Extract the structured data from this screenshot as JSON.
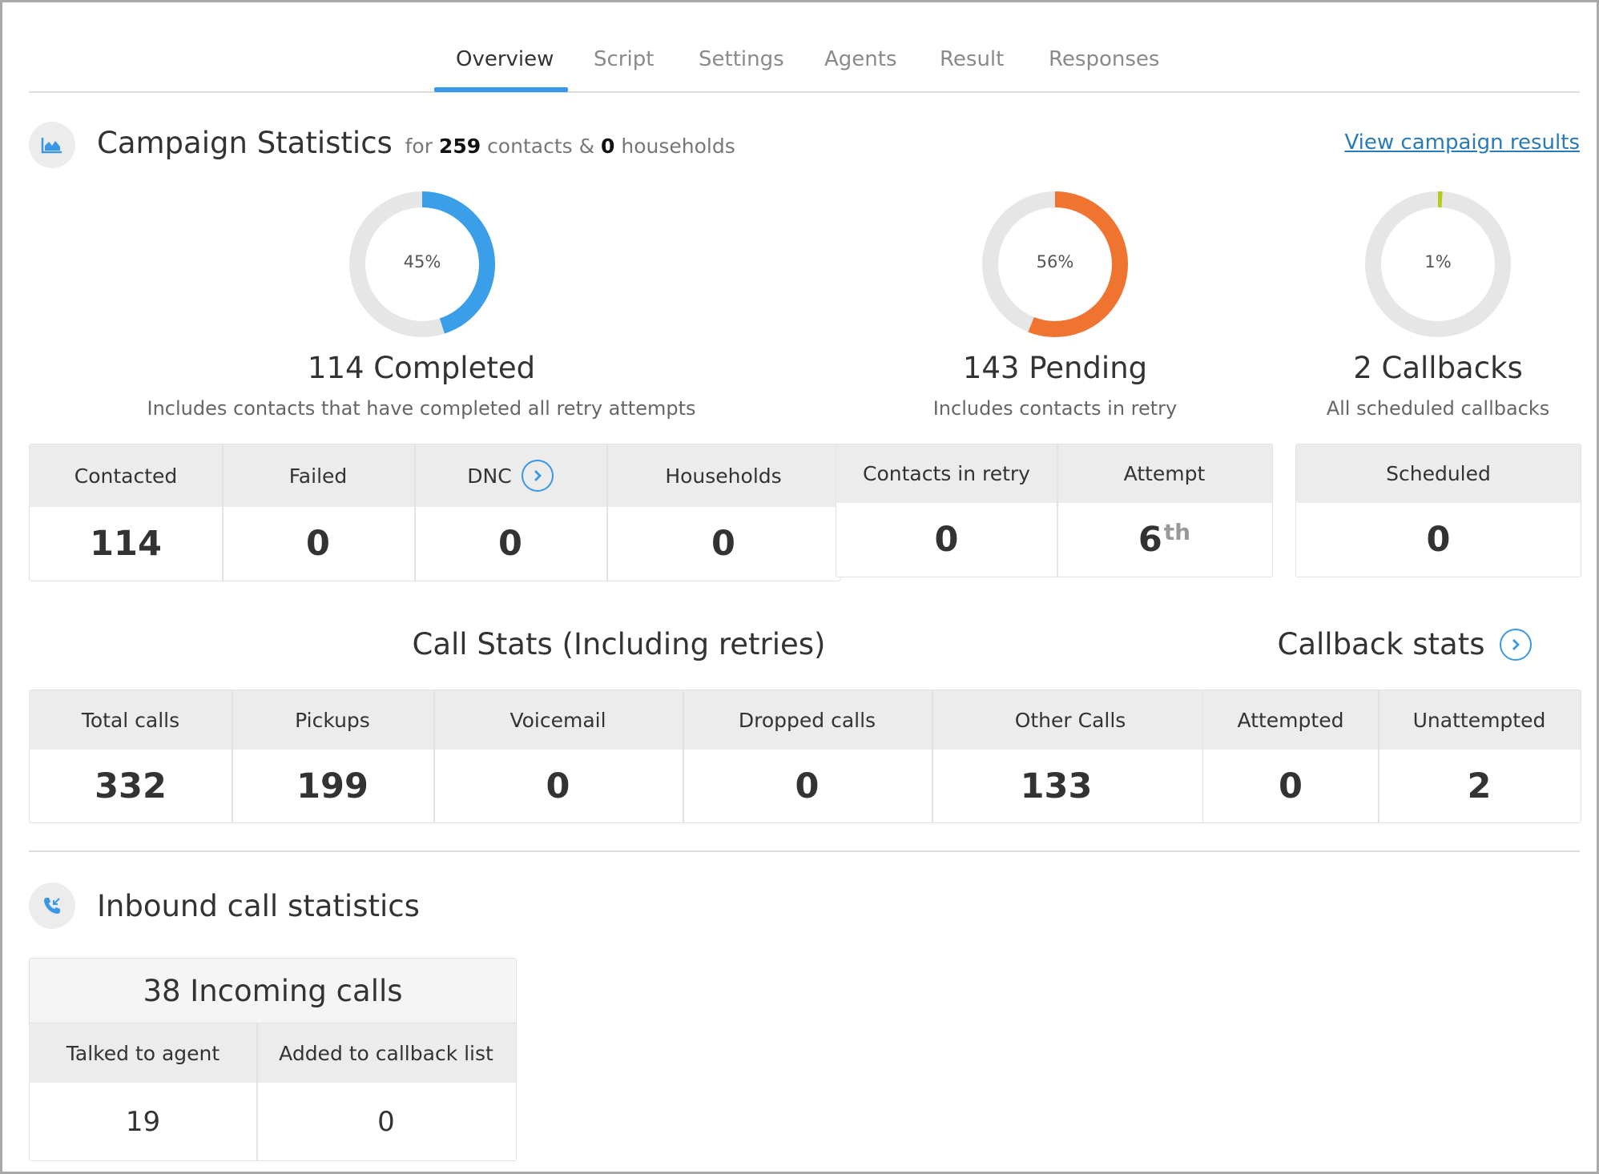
{
  "tabs": [
    {
      "label": "Overview",
      "active": true
    },
    {
      "label": "Script"
    },
    {
      "label": "Settings"
    },
    {
      "label": "Agents"
    },
    {
      "label": "Result"
    },
    {
      "label": "Responses"
    }
  ],
  "campaign": {
    "title": "Campaign Statistics",
    "sub_for": "for",
    "contacts": "259",
    "sub_contacts": "contacts &",
    "households": "0",
    "sub_households": "households",
    "link": "View campaign results"
  },
  "donuts": [
    {
      "percent_label": "45%",
      "fraction": 0.45,
      "color": "#3a9ee9",
      "headline": "114 Completed",
      "desc": "Includes contacts that have completed all retry attempts"
    },
    {
      "percent_label": "56%",
      "fraction": 0.56,
      "color": "#ef7430",
      "headline": "143 Pending",
      "desc": "Includes contacts in retry"
    },
    {
      "percent_label": "1%",
      "fraction": 0.01,
      "color": "#b5cc1a",
      "headline": "2 Callbacks",
      "desc": "All scheduled callbacks"
    }
  ],
  "completed_table": {
    "headers": [
      "Contacted",
      "Failed",
      "DNC",
      "Households"
    ],
    "values": [
      "114",
      "0",
      "0",
      "0"
    ]
  },
  "pending_table": {
    "headers": [
      "Contacts in retry",
      "Attempt"
    ],
    "values": [
      "0",
      "6"
    ],
    "attempt_suffix": "th"
  },
  "callbacks_table": {
    "headers": [
      "Scheduled"
    ],
    "values": [
      "0"
    ]
  },
  "call_stats": {
    "title": "Call Stats (Including retries)",
    "headers": [
      "Total calls",
      "Pickups",
      "Voicemail",
      "Dropped calls",
      "Other Calls"
    ],
    "values": [
      "332",
      "199",
      "0",
      "0",
      "133"
    ]
  },
  "callback_stats": {
    "title": "Callback stats",
    "headers": [
      "Attempted",
      "Unattempted"
    ],
    "values": [
      "0",
      "2"
    ]
  },
  "inbound": {
    "title": "Inbound call statistics",
    "incoming": "38 Incoming calls",
    "headers": [
      "Talked to agent",
      "Added to callback list"
    ],
    "values": [
      "19",
      "0"
    ]
  },
  "colors": {
    "accent": "#3a97e6",
    "link": "#2a7ab8"
  },
  "icons": {
    "campaign": "area-chart-icon",
    "inbound": "incoming-call-icon",
    "arrow": "chevron-right-icon"
  }
}
